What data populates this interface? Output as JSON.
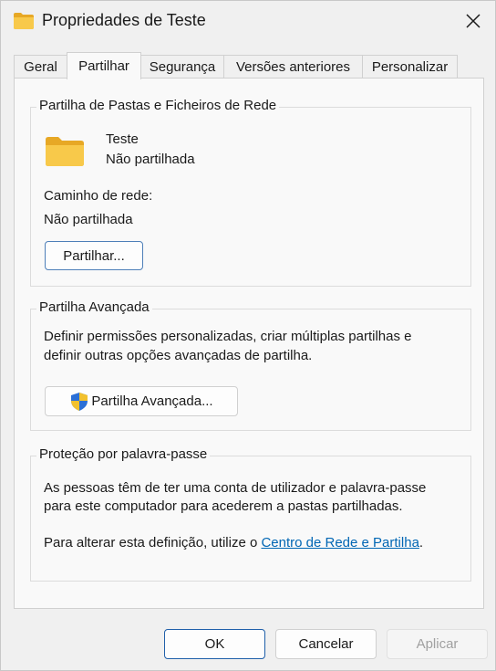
{
  "window": {
    "title": "Propriedades de Teste",
    "close_icon": "close-icon"
  },
  "tabs": [
    {
      "label": "Geral",
      "active": false
    },
    {
      "label": "Partilhar",
      "active": true
    },
    {
      "label": "Segurança",
      "active": false
    },
    {
      "label": "Versões anteriores",
      "active": false
    },
    {
      "label": "Personalizar",
      "active": false
    }
  ],
  "network_sharing": {
    "group_label": "Partilha de Pastas e Ficheiros de Rede",
    "folder_name": "Teste",
    "folder_status": "Não partilhada",
    "path_label": "Caminho de rede:",
    "path_value": "Não partilhada",
    "share_button": "Partilhar..."
  },
  "advanced_sharing": {
    "group_label": "Partilha Avançada",
    "description_line1": "Definir permissões personalizadas, criar múltiplas partilhas e",
    "description_line2": "definir outras opções avançadas de partilha.",
    "button_label": "Partilha Avançada...",
    "button_icon": "uac-shield-icon"
  },
  "password_protection": {
    "group_label": "Proteção por palavra-passe",
    "line1": "As pessoas têm de ter uma conta de utilizador e palavra-passe",
    "line2": "para este computador para acederem a pastas partilhadas.",
    "change_prefix": "Para alterar esta definição, utilize o ",
    "link_text": "Centro de Rede e Partilha",
    "change_suffix": "."
  },
  "footer": {
    "ok": "OK",
    "cancel": "Cancelar",
    "apply": "Aplicar"
  },
  "colors": {
    "accent": "#1f5fa9",
    "link": "#0066b4",
    "folder": "#f8c94a"
  }
}
